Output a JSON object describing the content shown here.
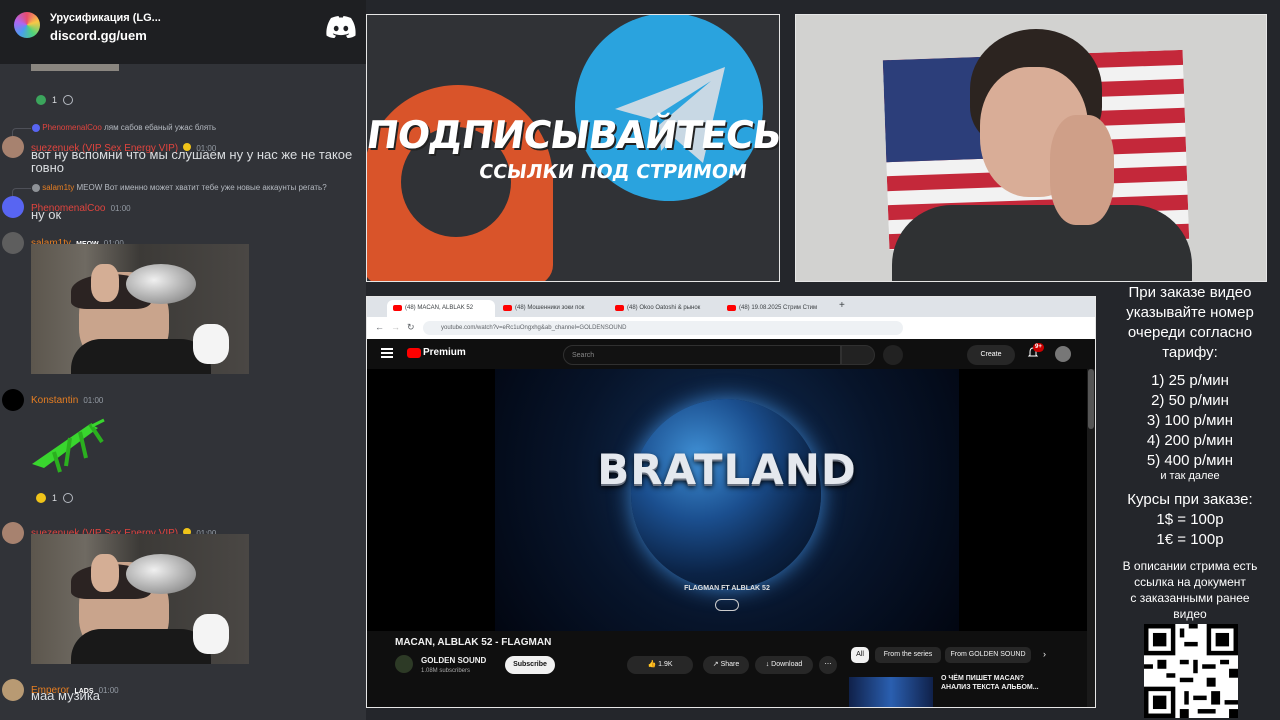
{
  "discord": {
    "server_title": "Урусификация (LG...",
    "invite": "discord.gg/uem",
    "reaction1_count": "1",
    "messages": [
      {
        "reply_user": "PhenomenalCoo",
        "reply_text": "лям сабов ебаный ужас блять",
        "user": "suezenuek (VIP Sex Energy VIP)",
        "time": "01:00",
        "text": "вот ну вспомни что мы слушаем ну у нас же не такое говно",
        "user_color": "#e0443e"
      },
      {
        "reply_user": "salam1ty",
        "reply_badge": "MEOW",
        "reply_text": "Вот именно может хватит тебе уже новые аккаунты регать?",
        "user": "PhenomenalCoo",
        "time": "01:00",
        "text": "ну ок",
        "user_color": "#e0443e"
      },
      {
        "user": "salam1ty",
        "badge": "MEOW",
        "time": "01:00",
        "user_color": "#e67e22"
      },
      {
        "user": "Konstantin",
        "time": "01:00",
        "user_color": "#e67e22",
        "reaction_count": "1"
      },
      {
        "user": "suezenuek (VIP Sex Energy VIP)",
        "time": "01:00",
        "user_color": "#e0443e"
      },
      {
        "user": "Emperor",
        "badge": "LADS",
        "time": "01:00",
        "text": "маа музика",
        "user_color": "#e67e22"
      }
    ]
  },
  "banner": {
    "line1": "ПОДПИСЫВАЙТЕСЬ",
    "line2": "ССЫЛКИ ПОД СТРИМОМ"
  },
  "browser": {
    "tabs": [
      "(48) MACAN, ALBLAK 52",
      "(48) Мошенники зоки пок",
      "(48) Okoo Oatoshi & рынок",
      "(48) 19.08.2025 Стрим Стим"
    ],
    "url": "youtube.com/watch?v=eRc1uOngxhg&ab_channel=GOLDENSOUND",
    "youtube": {
      "brand": "Premium",
      "search_placeholder": "Search",
      "create_label": "Create",
      "notif_badge": "9+",
      "video_title_overlay": "BRATLAND",
      "video_credit": "FLAGMAN FT ALBLAK 52",
      "video_title": "MACAN, ALBLAK 52 - FLAGMAN",
      "channel": "GOLDEN SOUND",
      "subscribers": "1.08M subscribers",
      "subscribe": "Subscribe",
      "likes": "1.9K",
      "share": "Share",
      "download": "Download",
      "chips": [
        "All",
        "From the series",
        "From GOLDEN SOUND"
      ],
      "rec_title": "О ЧЁМ ПИШЕТ MACAN? АНАЛИЗ ТЕКСТА АЛЬБОМ..."
    }
  },
  "info": {
    "intro": [
      "При заказе видео",
      "указывайте номер",
      "очереди согласно",
      "тарифу:"
    ],
    "prices": [
      "1) 25 р/мин",
      "2) 50 р/мин",
      "3) 100 р/мин",
      "4) 200 р/мин",
      "5) 400 р/мин"
    ],
    "etc": "и так далее",
    "rates_title": "Курсы при заказе:",
    "rates": [
      "1$ = 100р",
      "1€ = 100р"
    ],
    "desc": [
      "В описании стрима есть",
      "ссылка на документ",
      "с заказанными ранее",
      "видео"
    ]
  },
  "colors": {
    "discord_bg": "#313338",
    "youtube_red": "#ff0000",
    "accent_blue": "#2aa3de",
    "accent_orange": "#d9542a"
  }
}
